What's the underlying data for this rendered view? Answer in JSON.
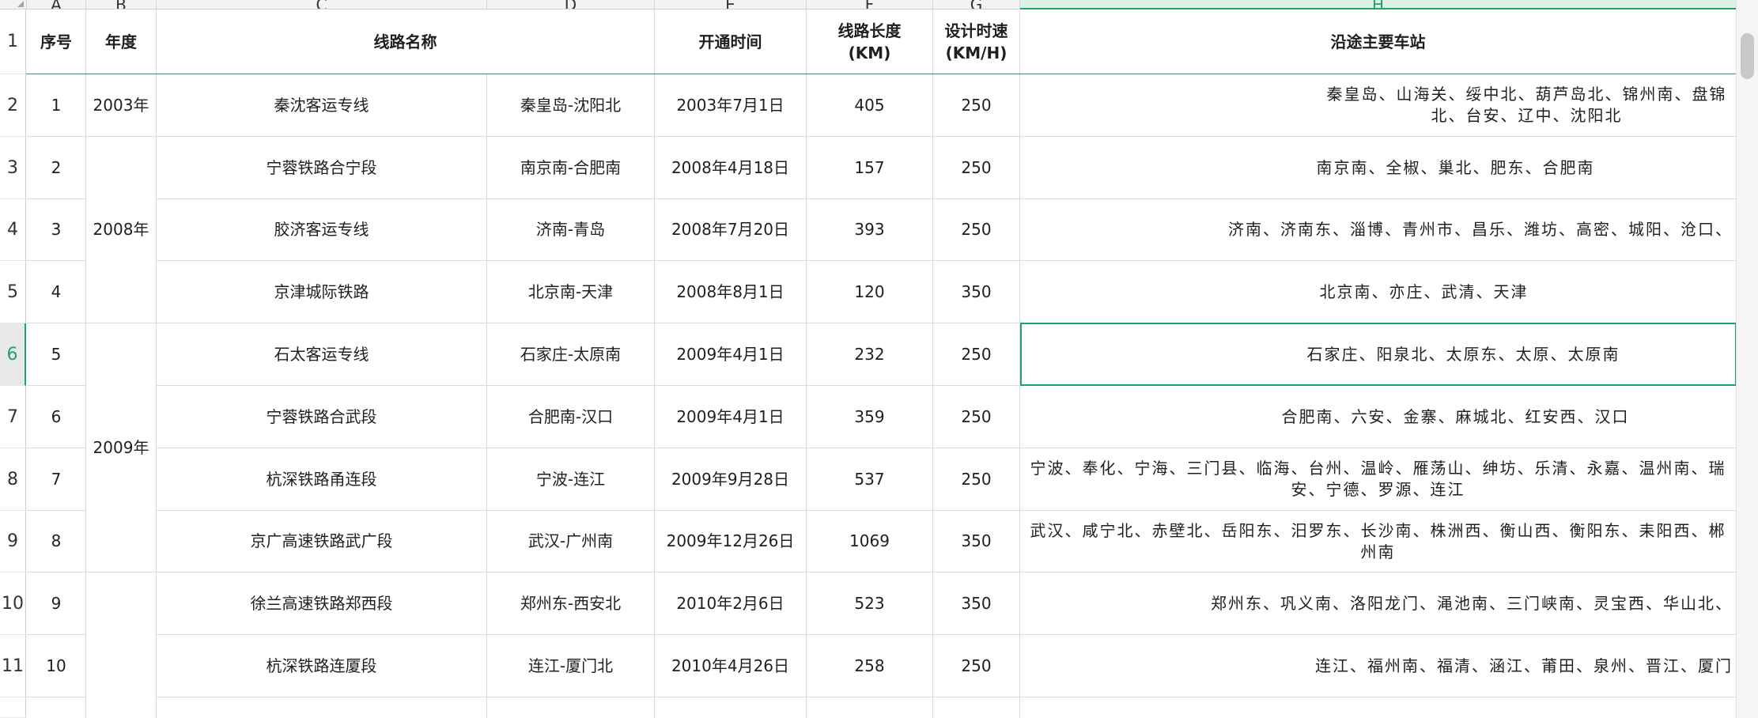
{
  "columns": [
    "A",
    "B",
    "C",
    "D",
    "E",
    "F",
    "G",
    "H"
  ],
  "active_column": "H",
  "active_row": 6,
  "header_row": {
    "row_num": "1",
    "seq": "序号",
    "year": "年度",
    "line_name": "线路名称",
    "open_time": "开通时间",
    "length_l1": "线路长度",
    "length_l2": "(KM)",
    "speed_l1": "设计时速",
    "speed_l2": "(KM/H)",
    "stations": "沿途主要车站"
  },
  "years": [
    {
      "label": "2003年"
    },
    {
      "label": "2008年"
    },
    {
      "label": "2009年"
    }
  ],
  "rows": [
    {
      "row_num": "2",
      "seq": "1",
      "name": "秦沈客运专线",
      "route": "秦皇岛-沈阳北",
      "date": "2003年7月1日",
      "length": "405",
      "speed": "250",
      "stations": "秦皇岛、山海关、绥中北、葫芦岛北、锦州南、盘锦北、台安、辽中、沈阳北"
    },
    {
      "row_num": "3",
      "seq": "2",
      "name": "宁蓉铁路合宁段",
      "route": "南京南-合肥南",
      "date": "2008年4月18日",
      "length": "157",
      "speed": "250",
      "stations": "南京南、全椒、巢北、肥东、合肥南"
    },
    {
      "row_num": "4",
      "seq": "3",
      "name": "胶济客运专线",
      "route": "济南-青岛",
      "date": "2008年7月20日",
      "length": "393",
      "speed": "250",
      "stations": "济南、济南东、淄博、青州市、昌乐、潍坊、高密、城阳、沧口、"
    },
    {
      "row_num": "5",
      "seq": "4",
      "name": "京津城际铁路",
      "route": "北京南-天津",
      "date": "2008年8月1日",
      "length": "120",
      "speed": "350",
      "stations": "北京南、亦庄、武清、天津"
    },
    {
      "row_num": "6",
      "seq": "5",
      "name": "石太客运专线",
      "route": "石家庄-太原南",
      "date": "2009年4月1日",
      "length": "232",
      "speed": "250",
      "stations": "石家庄、阳泉北、太原东、太原、太原南"
    },
    {
      "row_num": "7",
      "seq": "6",
      "name": "宁蓉铁路合武段",
      "route": "合肥南-汉口",
      "date": "2009年4月1日",
      "length": "359",
      "speed": "250",
      "stations": "合肥南、六安、金寨、麻城北、红安西、汉口"
    },
    {
      "row_num": "8",
      "seq": "7",
      "name": "杭深铁路甬连段",
      "route": "宁波-连江",
      "date": "2009年9月28日",
      "length": "537",
      "speed": "250",
      "stations": "宁波、奉化、宁海、三门县、临海、台州、温岭、雁荡山、绅坊、乐清、永嘉、温州南、瑞安、宁德、罗源、连江"
    },
    {
      "row_num": "9",
      "seq": "8",
      "name": "京广高速铁路武广段",
      "route": "武汉-广州南",
      "date": "2009年12月26日",
      "length": "1069",
      "speed": "350",
      "stations": "武汉、咸宁北、赤壁北、岳阳东、汨罗东、长沙南、株洲西、衡山西、衡阳东、耒阳西、郴州南"
    },
    {
      "row_num": "10",
      "seq": "9",
      "name": "徐兰高速铁路郑西段",
      "route": "郑州东-西安北",
      "date": "2010年2月6日",
      "length": "523",
      "speed": "350",
      "stations": "郑州东、巩义南、洛阳龙门、渑池南、三门峡南、灵宝西、华山北、"
    },
    {
      "row_num": "11",
      "seq": "10",
      "name": "杭深铁路连厦段",
      "route": "连江-厦门北",
      "date": "2010年4月26日",
      "length": "258",
      "speed": "250",
      "stations": "连江、福州南、福清、涵江、莆田、泉州、晋江、厦门"
    }
  ]
}
